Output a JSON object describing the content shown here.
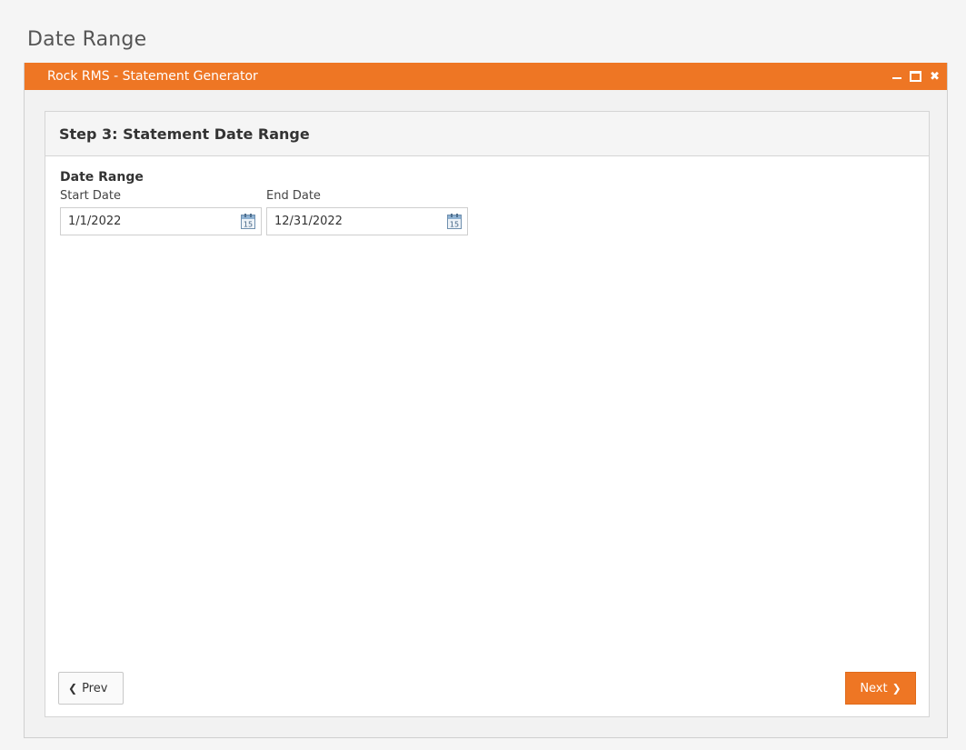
{
  "page": {
    "heading": "Date Range"
  },
  "window": {
    "title": "Rock RMS - Statement Generator",
    "controls": [
      "minimize-icon",
      "maximize-icon",
      "close-icon"
    ]
  },
  "panel": {
    "title": "Step 3: Statement Date Range",
    "section_label": "Date Range",
    "start_date": {
      "label": "Start Date",
      "value": "1/1/2022"
    },
    "end_date": {
      "label": "End Date",
      "value": "12/31/2022"
    },
    "calendar_icon_day": "15"
  },
  "footer": {
    "prev_label": "Prev",
    "next_label": "Next"
  },
  "colors": {
    "accent": "#ee7624",
    "panel_header_bg": "#f5f5f5",
    "window_bg": "#f2f2f2"
  }
}
